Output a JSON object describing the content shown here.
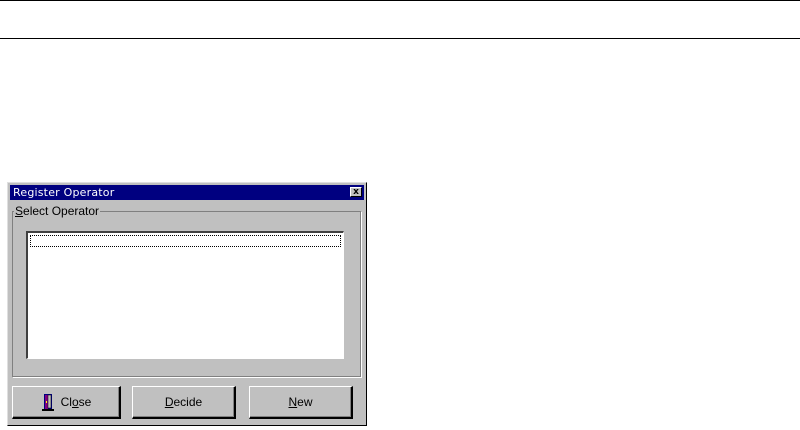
{
  "window": {
    "title": "Register Operator",
    "close_symbol": "x",
    "close_icon": "close-icon"
  },
  "group": {
    "label_accel": "S",
    "label_rest": "elect Operator"
  },
  "operator_list": {
    "items": [],
    "focus_row": 1
  },
  "buttons": {
    "close": {
      "icon": "door-icon",
      "label_pre": "Cl",
      "label_accel": "o",
      "label_post": "se"
    },
    "decide": {
      "label_accel": "D",
      "label_rest": "ecide"
    },
    "new": {
      "label_accel": "N",
      "label_rest": "ew"
    }
  },
  "colors": {
    "titlebar": "#000080",
    "face": "#c0c0c0"
  }
}
